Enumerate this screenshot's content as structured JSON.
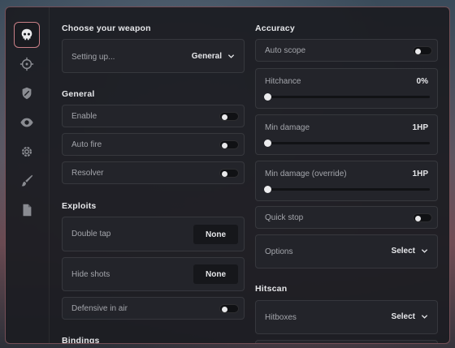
{
  "sidebar": {
    "items": [
      {
        "icon": "skull-icon",
        "active": true
      },
      {
        "icon": "crosshair-icon",
        "active": false
      },
      {
        "icon": "shield-icon",
        "active": false
      },
      {
        "icon": "eye-icon",
        "active": false
      },
      {
        "icon": "gear-icon",
        "active": false
      },
      {
        "icon": "brush-icon",
        "active": false
      },
      {
        "icon": "file-icon",
        "active": false
      }
    ]
  },
  "left": {
    "weapon_title": "Choose your weapon",
    "weapon_label": "Setting up...",
    "weapon_value": "General",
    "general_title": "General",
    "enable_label": "Enable",
    "autofire_label": "Auto fire",
    "resolver_label": "Resolver",
    "exploits_title": "Exploits",
    "doubletap_label": "Double tap",
    "doubletap_key": "None",
    "hideshots_label": "Hide shots",
    "hideshots_key": "None",
    "defensive_label": "Defensive in air",
    "bindings_title": "Bindings"
  },
  "right": {
    "accuracy_title": "Accuracy",
    "autoscope_label": "Auto scope",
    "hitchance_label": "Hitchance",
    "hitchance_value": "0%",
    "mindamage_label": "Min damage",
    "mindamage_value": "1HP",
    "mindamage_override_label": "Min damage (override)",
    "mindamage_override_value": "1HP",
    "quickstop_label": "Quick stop",
    "options_label": "Options",
    "options_value": "Select",
    "hitscan_title": "Hitscan",
    "hitboxes_label": "Hitboxes",
    "hitboxes_value": "Select"
  },
  "colors": {
    "accent": "#c87f86"
  }
}
